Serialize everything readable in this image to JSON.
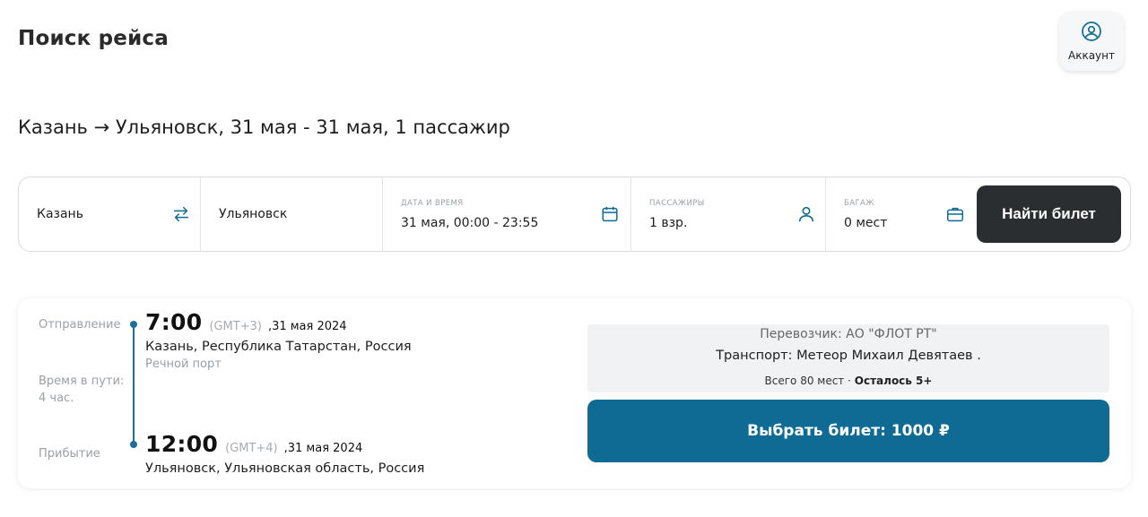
{
  "header": {
    "title": "Поиск рейса",
    "account_label": "Аккаунт"
  },
  "route_summary": "Казань → Ульяновск, 31 мая - 31 мая, 1 пассажир",
  "search": {
    "from": "Казань",
    "to": "Ульяновск",
    "date_caption": "ДАТА И ВРЕМЯ",
    "date_value": "31 мая, 00:00 - 23:55",
    "passengers_caption": "ПАССАЖИРЫ",
    "passengers_value": "1 взр.",
    "baggage_caption": "БАГАЖ",
    "baggage_value": "0 мест",
    "find_button": "Найти билет"
  },
  "trip": {
    "departure_label": "Отправление",
    "duration_label": "Время в пути:",
    "duration_value": "4 час.",
    "arrival_label": "Прибытие",
    "departure": {
      "time": "7:00",
      "tz": "(GMT+3)",
      "date": ",31 мая 2024",
      "place": "Казань, Республика Татарстан, Россия",
      "terminal": "Речной порт"
    },
    "arrival": {
      "time": "12:00",
      "tz": "(GMT+4)",
      "date": ",31 мая 2024",
      "place": "Ульяновск, Ульяновская область, Россия"
    },
    "carrier": "Перевозчик: АО \"ФЛОТ РТ\"",
    "transport": "Транспорт: Метеор Михаил Девятаев .",
    "seats_total": "Всего 80 мест",
    "seats_separator": "·",
    "seats_left": "Осталось 5+",
    "select_button": "Выбрать билет: 1000 ₽"
  },
  "colors": {
    "accent": "#0f6b94",
    "dark_button": "#2b2e30",
    "timeline": "#1b6f98"
  }
}
